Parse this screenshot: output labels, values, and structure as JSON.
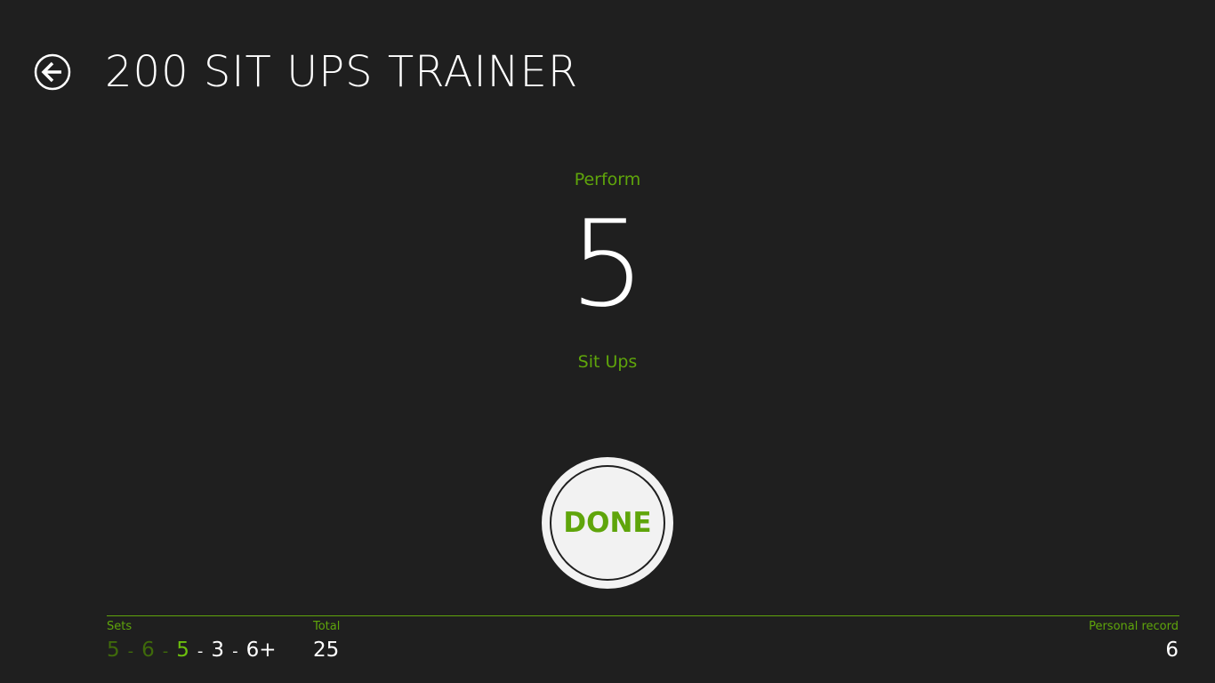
{
  "header": {
    "title": "200 SIT UPS TRAINER",
    "back_icon": "back-arrow-icon"
  },
  "workout": {
    "perform_label": "Perform",
    "count": "5",
    "unit_label": "Sit Ups"
  },
  "done_button": {
    "label": "DONE"
  },
  "footer": {
    "sets_label": "Sets",
    "sets": [
      {
        "value": "5",
        "state": "done"
      },
      {
        "value": "6",
        "state": "done"
      },
      {
        "value": "5",
        "state": "current"
      },
      {
        "value": "3",
        "state": "upcoming"
      },
      {
        "value": "6+",
        "state": "upcoming"
      }
    ],
    "separator": "-",
    "total_label": "Total",
    "total_value": "25",
    "record_label": "Personal record",
    "record_value": "6"
  },
  "colors": {
    "background": "#1f1f1f",
    "accent": "#5fa50b",
    "completed_set": "#3f6a0a",
    "current_set": "#6cbf0d",
    "text": "#ffffff"
  }
}
